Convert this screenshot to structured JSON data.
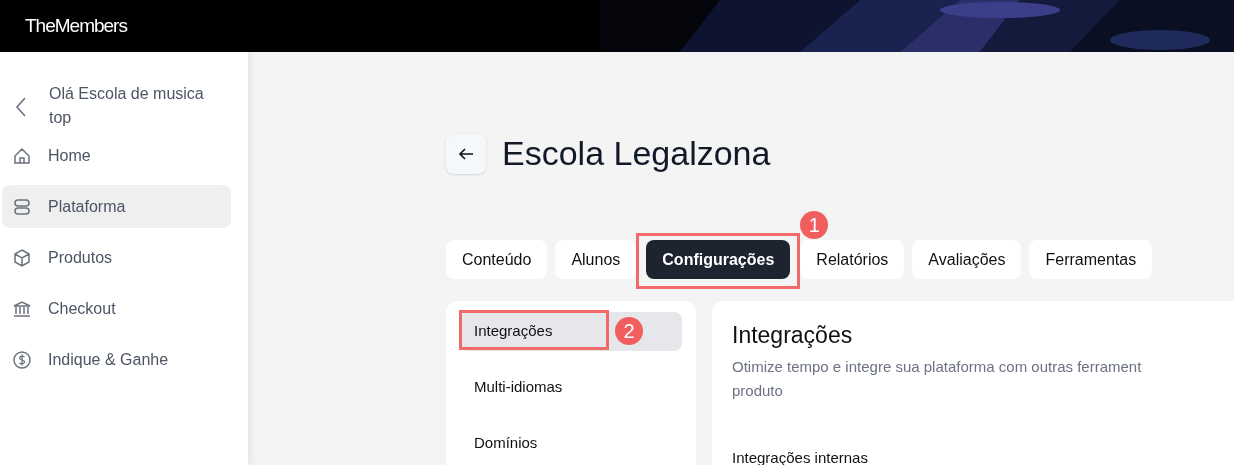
{
  "brand": {
    "logo": "TheMembers"
  },
  "sidebar": {
    "greeting": "Olá Escola de musica top",
    "items": [
      {
        "label": "Home",
        "selected": false
      },
      {
        "label": "Plataforma",
        "selected": true
      },
      {
        "label": "Produtos",
        "selected": false
      },
      {
        "label": "Checkout",
        "selected": false
      },
      {
        "label": "Indique & Ganhe",
        "selected": false
      }
    ]
  },
  "page": {
    "title": "Escola Legalzona"
  },
  "tabs": [
    {
      "label": "Conteúdo",
      "selected": false
    },
    {
      "label": "Alunos",
      "selected": false
    },
    {
      "label": "Configurações",
      "selected": true,
      "callout": "1"
    },
    {
      "label": "Relatórios",
      "selected": false
    },
    {
      "label": "Avaliações",
      "selected": false
    },
    {
      "label": "Ferramentas",
      "selected": false
    }
  ],
  "settings_nav": [
    {
      "label": "Integrações",
      "selected": true,
      "callout": "2"
    },
    {
      "label": "Multi-idiomas",
      "selected": false
    },
    {
      "label": "Domínios",
      "selected": false
    }
  ],
  "panel": {
    "title": "Integrações",
    "description_lines": [
      "Otimize tempo e integre sua plataforma com outras ferrament",
      "produto"
    ],
    "section_heading": "Integrações internas"
  }
}
